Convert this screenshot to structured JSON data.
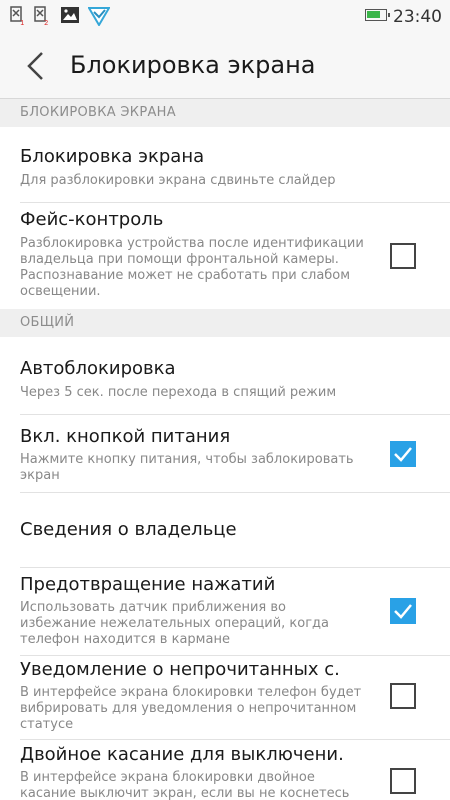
{
  "status": {
    "time": "23:40",
    "icons": [
      "sim1-no-signal-icon",
      "sim2-no-signal-icon",
      "gallery-icon",
      "shield-icon"
    ],
    "battery_level": 0.75,
    "battery_color": "#3bb54a"
  },
  "header": {
    "title": "Блокировка экрана"
  },
  "sections": [
    {
      "label": "БЛОКИРОВКА ЭКРАНА"
    },
    {
      "label": "ОБЩИЙ"
    }
  ],
  "rows": [
    {
      "title": "Блокировка экрана",
      "desc": "Для разблокировки экрана сдвиньте слайдер"
    },
    {
      "title": "Фейс-контроль",
      "desc": "Разблокировка устройства после идентификации владельца при помощи фронтальной камеры. Распознавание может не сработать при слабом освещении.",
      "checked": false
    },
    {
      "title": "Автоблокировка",
      "desc": "Через 5 сек. после перехода в спящий режим"
    },
    {
      "title": "Вкл. кнопкой питания",
      "desc": "Нажмите кнопку питания, чтобы заблокировать экран",
      "checked": true
    },
    {
      "title": "Сведения о владельце"
    },
    {
      "title": "Предотвращение нажатий",
      "desc": "Использовать датчик приближения во избежание нежелательных операций, когда телефон находится в кармане",
      "checked": true
    },
    {
      "title": "Уведомление о непрочитанных с.",
      "desc": "В интерфейсе экрана блокировки телефон будет вибрировать для уведомления о непрочитанном статусе",
      "checked": false
    },
    {
      "title": "Двойное касание для выключени.",
      "desc": "В интерфейсе экрана блокировки двойное касание выключит экран, если вы не коснетесь",
      "checked": false
    }
  ],
  "colors": {
    "accent": "#29a1e6",
    "section_bg": "#efefef",
    "bar_bg": "#f7f7f7"
  }
}
